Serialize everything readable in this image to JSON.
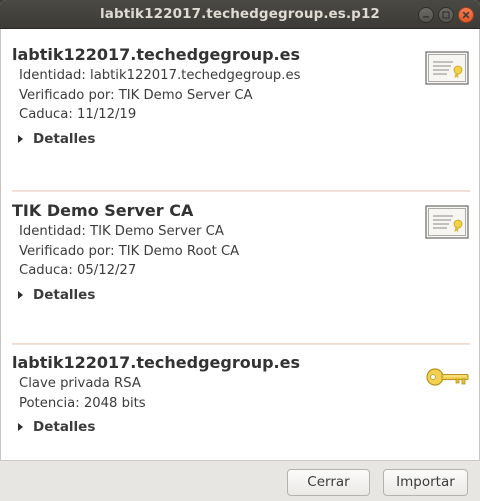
{
  "window": {
    "title": "labtik122017.techedgegroup.es.p12"
  },
  "sections": [
    {
      "title": "labtik122017.techedgegroup.es",
      "lines": [
        "Identidad: labtik122017.techedgegroup.es",
        "Verificado por: TIK Demo Server CA",
        "Caduca: 11/12/19"
      ],
      "details_label": "Detalles",
      "icon": "certificate-icon"
    },
    {
      "title": "TIK Demo Server CA",
      "lines": [
        "Identidad: TIK Demo Server CA",
        "Verificado por: TIK Demo Root CA",
        "Caduca: 05/12/27"
      ],
      "details_label": "Detalles",
      "icon": "certificate-icon"
    },
    {
      "title": "labtik122017.techedgegroup.es",
      "lines": [
        "Clave privada RSA",
        "Potencia: 2048 bits"
      ],
      "details_label": "Detalles",
      "icon": "key-icon"
    }
  ],
  "buttons": {
    "close_label": "Cerrar",
    "import_label": "Importar"
  },
  "colors": {
    "titlebar": "#3c3b37",
    "close_button": "#e95420",
    "key": "#e8c33a"
  }
}
